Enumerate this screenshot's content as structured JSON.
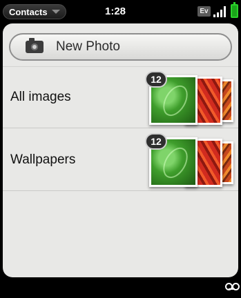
{
  "status_bar": {
    "app_menu_label": "Contacts",
    "time": "1:28",
    "network_label": "Ev",
    "icons": [
      "chevron-down-icon",
      "signal-icon",
      "battery-icon",
      "voicemail-icon"
    ],
    "battery_color": "#2bd12b"
  },
  "new_photo_button": {
    "label": "New Photo",
    "icon": "camera-icon"
  },
  "albums": [
    {
      "label": "All images",
      "count": "12"
    },
    {
      "label": "Wallpapers",
      "count": "12"
    }
  ],
  "colors": {
    "card_background": "#e8e8e6",
    "screen_background": "#000000"
  }
}
